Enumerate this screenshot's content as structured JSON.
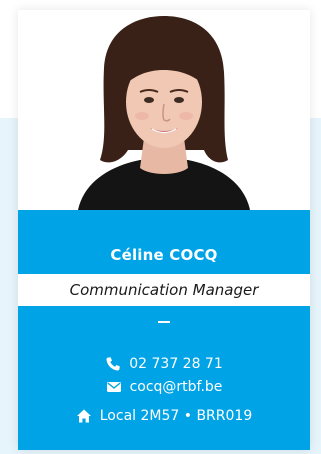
{
  "profile": {
    "name": "Céline COCQ",
    "role": "Communication Manager",
    "separator": "—"
  },
  "contact": {
    "phone": "02 737 28 71",
    "email": "cocq@rtbf.be",
    "office": "Local 2M57 • BRR019"
  },
  "icons": {
    "phone": "phone-icon",
    "email": "envelope-icon",
    "office": "home-icon"
  },
  "colors": {
    "accent": "#00a3e6",
    "background_band": "#e6f4fb",
    "role_text": "#1a1a1a"
  }
}
